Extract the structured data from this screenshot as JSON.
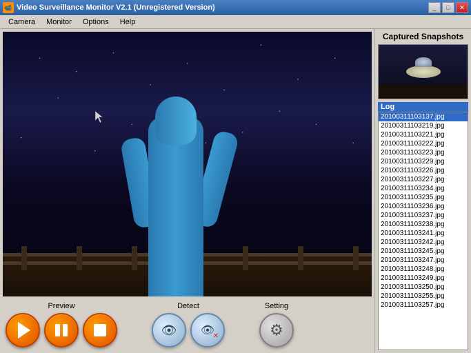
{
  "window": {
    "title": "Video Surveillance Monitor V2.1 (Unregistered Version)",
    "icon_label": "cam-icon"
  },
  "title_buttons": {
    "minimize_label": "_",
    "maximize_label": "□",
    "close_label": "✕"
  },
  "menu": {
    "items": [
      {
        "label": "Camera"
      },
      {
        "label": "Monitor"
      },
      {
        "label": "Options"
      },
      {
        "label": "Help"
      }
    ]
  },
  "right_panel": {
    "snapshots_label": "Captured Snapshots",
    "log_label": "Log"
  },
  "controls": {
    "preview_label": "Preview",
    "detect_label": "Detect",
    "setting_label": "Setting"
  },
  "log_items": [
    {
      "filename": "20100311103137.jpg",
      "selected": true
    },
    {
      "filename": "20100311103219.jpg",
      "selected": false
    },
    {
      "filename": "20100311103221.jpg",
      "selected": false
    },
    {
      "filename": "20100311103222.jpg",
      "selected": false
    },
    {
      "filename": "20100311103223.jpg",
      "selected": false
    },
    {
      "filename": "20100311103229.jpg",
      "selected": false
    },
    {
      "filename": "20100311103226.jpg",
      "selected": false
    },
    {
      "filename": "20100311103227.jpg",
      "selected": false
    },
    {
      "filename": "20100311103234.jpg",
      "selected": false
    },
    {
      "filename": "20100311103235.jpg",
      "selected": false
    },
    {
      "filename": "20100311103236.jpg",
      "selected": false
    },
    {
      "filename": "20100311103237.jpg",
      "selected": false
    },
    {
      "filename": "20100311103238.jpg",
      "selected": false
    },
    {
      "filename": "20100311103241.jpg",
      "selected": false
    },
    {
      "filename": "20100311103242.jpg",
      "selected": false
    },
    {
      "filename": "20100311103245.jpg",
      "selected": false
    },
    {
      "filename": "20100311103247.jpg",
      "selected": false
    },
    {
      "filename": "20100311103248.jpg",
      "selected": false
    },
    {
      "filename": "20100311103249.jpg",
      "selected": false
    },
    {
      "filename": "20100311103250.jpg",
      "selected": false
    },
    {
      "filename": "20100311103255.jpg",
      "selected": false
    },
    {
      "filename": "20100311103257.jpg",
      "selected": false
    }
  ]
}
